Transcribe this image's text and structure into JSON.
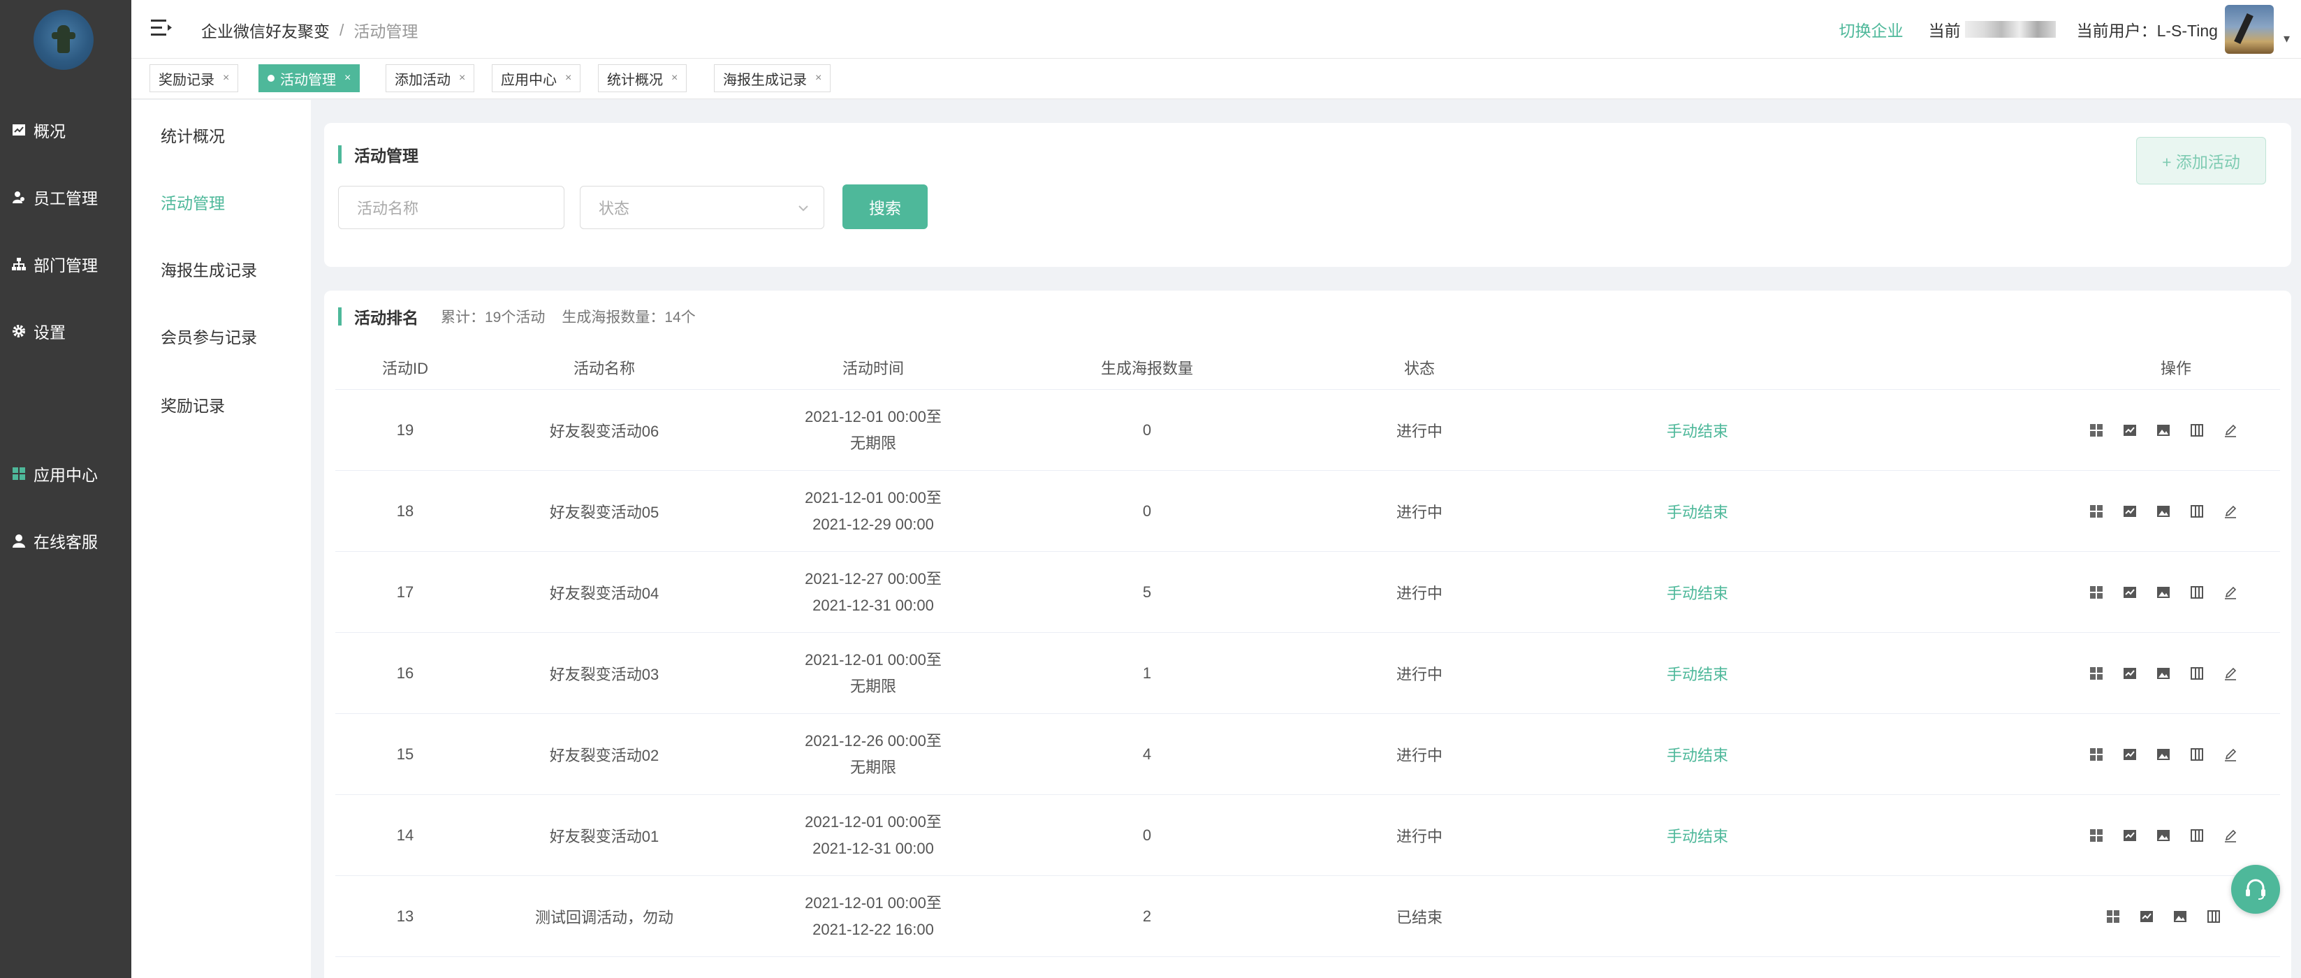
{
  "sidebar": {
    "items": [
      {
        "label": "概况",
        "icon": "chart-icon"
      },
      {
        "label": "员工管理",
        "icon": "users-icon"
      },
      {
        "label": "部门管理",
        "icon": "org-icon"
      },
      {
        "label": "设置",
        "icon": "gear-icon"
      },
      {
        "label": "应用中心",
        "icon": "apps-icon"
      },
      {
        "label": "在线客服",
        "icon": "person-icon"
      }
    ]
  },
  "header": {
    "breadcrumb_root": "企业微信好友聚变",
    "breadcrumb_sep": "/",
    "breadcrumb_current": "活动管理",
    "switch_enterprise": "切换企业",
    "current_enterprise_label": "当前",
    "current_user_label": "当前用户：",
    "current_user": "L-S-Ting",
    "caret": "▾"
  },
  "tabs": [
    {
      "label": "奖励记录",
      "active": false
    },
    {
      "label": "活动管理",
      "active": true
    },
    {
      "label": "添加活动",
      "active": false
    },
    {
      "label": "应用中心",
      "active": false
    },
    {
      "label": "统计概况",
      "active": false
    },
    {
      "label": "海报生成记录",
      "active": false
    }
  ],
  "tab_close": "×",
  "submenu": [
    {
      "label": "统计概况",
      "active": false
    },
    {
      "label": "活动管理",
      "active": true
    },
    {
      "label": "海报生成记录",
      "active": false
    },
    {
      "label": "会员参与记录",
      "active": false
    },
    {
      "label": "奖励记录",
      "active": false
    }
  ],
  "filter": {
    "title": "活动管理",
    "name_placeholder": "活动名称",
    "status_placeholder": "状态",
    "search_label": "搜索",
    "add_label": "+ 添加活动"
  },
  "ranking": {
    "title": "活动排名",
    "total": "累计：19个活动",
    "posters": "生成海报数量：14个",
    "columns": [
      "活动ID",
      "活动名称",
      "活动时间",
      "生成海报数量",
      "状态",
      "操作"
    ],
    "rows": [
      {
        "id": "19",
        "name": "好友裂变活动06",
        "start": "2021-12-01 00:00至",
        "end": "无期限",
        "posters": "0",
        "status": "进行中",
        "action": "手动结束"
      },
      {
        "id": "18",
        "name": "好友裂变活动05",
        "start": "2021-12-01 00:00至",
        "end": "2021-12-29 00:00",
        "posters": "0",
        "status": "进行中",
        "action": "手动结束"
      },
      {
        "id": "17",
        "name": "好友裂变活动04",
        "start": "2021-12-27 00:00至",
        "end": "2021-12-31 00:00",
        "posters": "5",
        "status": "进行中",
        "action": "手动结束"
      },
      {
        "id": "16",
        "name": "好友裂变活动03",
        "start": "2021-12-01 00:00至",
        "end": "无期限",
        "posters": "1",
        "status": "进行中",
        "action": "手动结束"
      },
      {
        "id": "15",
        "name": "好友裂变活动02",
        "start": "2021-12-26 00:00至",
        "end": "无期限",
        "posters": "4",
        "status": "进行中",
        "action": "手动结束"
      },
      {
        "id": "14",
        "name": "好友裂变活动01",
        "start": "2021-12-01 00:00至",
        "end": "2021-12-31 00:00",
        "posters": "0",
        "status": "进行中",
        "action": "手动结束"
      },
      {
        "id": "13",
        "name": "测试回调活动，勿动",
        "start": "2021-12-01 00:00至",
        "end": "2021-12-22 16:00",
        "posters": "2",
        "status": "已结束",
        "action": ""
      }
    ]
  },
  "colors": {
    "accent": "#4eb89a",
    "sidebar_bg": "#3a3a3a"
  }
}
